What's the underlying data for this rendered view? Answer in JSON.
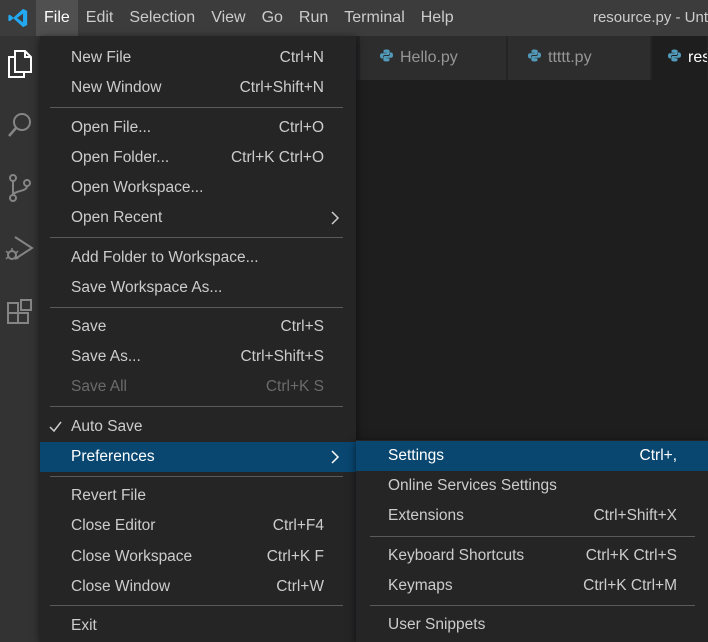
{
  "menubar": {
    "items": [
      "File",
      "Edit",
      "Selection",
      "View",
      "Go",
      "Run",
      "Terminal",
      "Help"
    ],
    "active": "File"
  },
  "window_title": "resource.py - Unt",
  "tabs": [
    {
      "label": "Hello.py",
      "active": false
    },
    {
      "label": "ttttt.py",
      "active": false
    },
    {
      "label": "res",
      "active": true
    }
  ],
  "activity_icons": [
    "explorer-icon",
    "search-icon",
    "source-control-icon",
    "run-debug-icon",
    "extensions-icon"
  ],
  "file_menu": {
    "new_file": {
      "label": "New File",
      "shortcut": "Ctrl+N"
    },
    "new_window": {
      "label": "New Window",
      "shortcut": "Ctrl+Shift+N"
    },
    "open_file": {
      "label": "Open File...",
      "shortcut": "Ctrl+O"
    },
    "open_folder": {
      "label": "Open Folder...",
      "shortcut": "Ctrl+K Ctrl+O"
    },
    "open_workspace": {
      "label": "Open Workspace..."
    },
    "open_recent": {
      "label": "Open Recent"
    },
    "add_folder": {
      "label": "Add Folder to Workspace..."
    },
    "save_workspace_as": {
      "label": "Save Workspace As..."
    },
    "save": {
      "label": "Save",
      "shortcut": "Ctrl+S"
    },
    "save_as": {
      "label": "Save As...",
      "shortcut": "Ctrl+Shift+S"
    },
    "save_all": {
      "label": "Save All",
      "shortcut": "Ctrl+K S"
    },
    "auto_save": {
      "label": "Auto Save",
      "checked": true
    },
    "preferences": {
      "label": "Preferences"
    },
    "revert_file": {
      "label": "Revert File"
    },
    "close_editor": {
      "label": "Close Editor",
      "shortcut": "Ctrl+F4"
    },
    "close_workspace": {
      "label": "Close Workspace",
      "shortcut": "Ctrl+K F"
    },
    "close_window": {
      "label": "Close Window",
      "shortcut": "Ctrl+W"
    },
    "exit": {
      "label": "Exit"
    }
  },
  "preferences_menu": {
    "settings": {
      "label": "Settings",
      "shortcut": "Ctrl+,"
    },
    "online_services": {
      "label": "Online Services Settings"
    },
    "extensions": {
      "label": "Extensions",
      "shortcut": "Ctrl+Shift+X"
    },
    "keyboard_shortcuts": {
      "label": "Keyboard Shortcuts",
      "shortcut": "Ctrl+K Ctrl+S"
    },
    "keymaps": {
      "label": "Keymaps",
      "shortcut": "Ctrl+K Ctrl+M"
    },
    "user_snippets": {
      "label": "User Snippets"
    }
  },
  "colors": {
    "accent": "#0e63a8",
    "selection": "#094771",
    "vscode_blue": "#23a9f2"
  }
}
